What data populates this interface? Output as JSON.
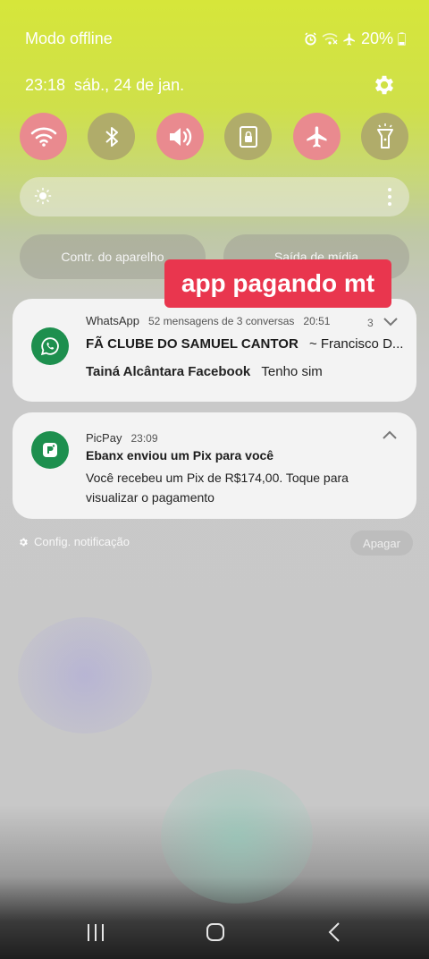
{
  "status_bar": {
    "carrier": "Modo offline",
    "battery": "20%",
    "icons": [
      "alarm-icon",
      "wifi-off-icon",
      "airplane-icon",
      "battery-icon"
    ]
  },
  "header": {
    "time": "23:18",
    "date": "sáb., 24 de jan."
  },
  "quick_toggles": [
    {
      "name": "wifi",
      "icon": "wifi-icon",
      "state": "on"
    },
    {
      "name": "bluetooth",
      "icon": "bluetooth-icon",
      "state": "off"
    },
    {
      "name": "sound",
      "icon": "volume-icon",
      "state": "on"
    },
    {
      "name": "rotation-lock",
      "icon": "lock-icon",
      "state": "off"
    },
    {
      "name": "airplane",
      "icon": "airplane-icon",
      "state": "on"
    },
    {
      "name": "flashlight",
      "icon": "flashlight-icon",
      "state": "off"
    }
  ],
  "device_controls": {
    "label": "Contr. do aparelho",
    "media_output": "Saída de mídia"
  },
  "overlay_sticker": "app pagando mt",
  "notifications": [
    {
      "app": "WhatsApp",
      "summary": "52 mensagens de 3 conversas",
      "time": "20:51",
      "count": "3",
      "title": "FÃ CLUBE  DO SAMUEL CANTOR",
      "title_suffix": "~ Francisco D...",
      "sender": "Tainá Alcântara Facebook",
      "message": "Tenho sim"
    },
    {
      "app": "PicPay",
      "time": "23:09",
      "title": "Ebanx enviou um Pix para você",
      "body_line1": "Você recebeu um Pix de R$174,00. Toque para",
      "body_line2": "visualizar o pagamento"
    }
  ],
  "footer": {
    "settings_label": "Config. notificação",
    "clear_label": "Apagar"
  },
  "colors": {
    "toggle_on": "#e98a8f",
    "toggle_off": "#b0ac6a",
    "sticker": "#e9364e",
    "whatsapp_green": "#1d8f4e"
  }
}
